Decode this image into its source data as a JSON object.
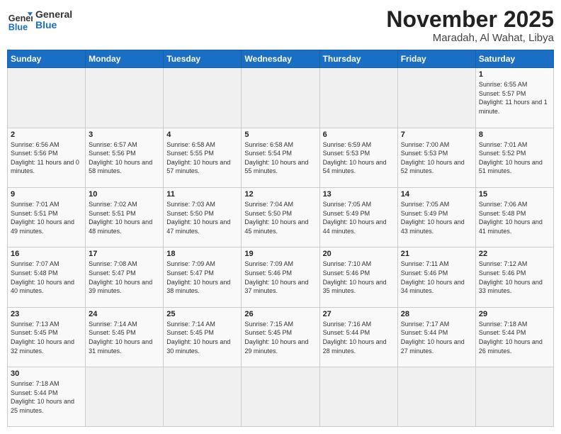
{
  "header": {
    "logo_general": "General",
    "logo_blue": "Blue",
    "month_title": "November 2025",
    "subtitle": "Maradah, Al Wahat, Libya"
  },
  "days_of_week": [
    "Sunday",
    "Monday",
    "Tuesday",
    "Wednesday",
    "Thursday",
    "Friday",
    "Saturday"
  ],
  "weeks": [
    [
      {
        "day": "",
        "sunrise": "",
        "sunset": "",
        "daylight": ""
      },
      {
        "day": "",
        "sunrise": "",
        "sunset": "",
        "daylight": ""
      },
      {
        "day": "",
        "sunrise": "",
        "sunset": "",
        "daylight": ""
      },
      {
        "day": "",
        "sunrise": "",
        "sunset": "",
        "daylight": ""
      },
      {
        "day": "",
        "sunrise": "",
        "sunset": "",
        "daylight": ""
      },
      {
        "day": "",
        "sunrise": "",
        "sunset": "",
        "daylight": ""
      },
      {
        "day": "1",
        "sunrise": "6:55 AM",
        "sunset": "5:57 PM",
        "daylight": "11 hours and 1 minute."
      }
    ],
    [
      {
        "day": "2",
        "sunrise": "6:56 AM",
        "sunset": "5:56 PM",
        "daylight": "11 hours and 0 minutes."
      },
      {
        "day": "3",
        "sunrise": "6:57 AM",
        "sunset": "5:56 PM",
        "daylight": "10 hours and 58 minutes."
      },
      {
        "day": "4",
        "sunrise": "6:58 AM",
        "sunset": "5:55 PM",
        "daylight": "10 hours and 57 minutes."
      },
      {
        "day": "5",
        "sunrise": "6:58 AM",
        "sunset": "5:54 PM",
        "daylight": "10 hours and 55 minutes."
      },
      {
        "day": "6",
        "sunrise": "6:59 AM",
        "sunset": "5:53 PM",
        "daylight": "10 hours and 54 minutes."
      },
      {
        "day": "7",
        "sunrise": "7:00 AM",
        "sunset": "5:53 PM",
        "daylight": "10 hours and 52 minutes."
      },
      {
        "day": "8",
        "sunrise": "7:01 AM",
        "sunset": "5:52 PM",
        "daylight": "10 hours and 51 minutes."
      }
    ],
    [
      {
        "day": "9",
        "sunrise": "7:01 AM",
        "sunset": "5:51 PM",
        "daylight": "10 hours and 49 minutes."
      },
      {
        "day": "10",
        "sunrise": "7:02 AM",
        "sunset": "5:51 PM",
        "daylight": "10 hours and 48 minutes."
      },
      {
        "day": "11",
        "sunrise": "7:03 AM",
        "sunset": "5:50 PM",
        "daylight": "10 hours and 47 minutes."
      },
      {
        "day": "12",
        "sunrise": "7:04 AM",
        "sunset": "5:50 PM",
        "daylight": "10 hours and 45 minutes."
      },
      {
        "day": "13",
        "sunrise": "7:05 AM",
        "sunset": "5:49 PM",
        "daylight": "10 hours and 44 minutes."
      },
      {
        "day": "14",
        "sunrise": "7:05 AM",
        "sunset": "5:49 PM",
        "daylight": "10 hours and 43 minutes."
      },
      {
        "day": "15",
        "sunrise": "7:06 AM",
        "sunset": "5:48 PM",
        "daylight": "10 hours and 41 minutes."
      }
    ],
    [
      {
        "day": "16",
        "sunrise": "7:07 AM",
        "sunset": "5:48 PM",
        "daylight": "10 hours and 40 minutes."
      },
      {
        "day": "17",
        "sunrise": "7:08 AM",
        "sunset": "5:47 PM",
        "daylight": "10 hours and 39 minutes."
      },
      {
        "day": "18",
        "sunrise": "7:09 AM",
        "sunset": "5:47 PM",
        "daylight": "10 hours and 38 minutes."
      },
      {
        "day": "19",
        "sunrise": "7:09 AM",
        "sunset": "5:46 PM",
        "daylight": "10 hours and 37 minutes."
      },
      {
        "day": "20",
        "sunrise": "7:10 AM",
        "sunset": "5:46 PM",
        "daylight": "10 hours and 35 minutes."
      },
      {
        "day": "21",
        "sunrise": "7:11 AM",
        "sunset": "5:46 PM",
        "daylight": "10 hours and 34 minutes."
      },
      {
        "day": "22",
        "sunrise": "7:12 AM",
        "sunset": "5:46 PM",
        "daylight": "10 hours and 33 minutes."
      }
    ],
    [
      {
        "day": "23",
        "sunrise": "7:13 AM",
        "sunset": "5:45 PM",
        "daylight": "10 hours and 32 minutes."
      },
      {
        "day": "24",
        "sunrise": "7:14 AM",
        "sunset": "5:45 PM",
        "daylight": "10 hours and 31 minutes."
      },
      {
        "day": "25",
        "sunrise": "7:14 AM",
        "sunset": "5:45 PM",
        "daylight": "10 hours and 30 minutes."
      },
      {
        "day": "26",
        "sunrise": "7:15 AM",
        "sunset": "5:45 PM",
        "daylight": "10 hours and 29 minutes."
      },
      {
        "day": "27",
        "sunrise": "7:16 AM",
        "sunset": "5:44 PM",
        "daylight": "10 hours and 28 minutes."
      },
      {
        "day": "28",
        "sunrise": "7:17 AM",
        "sunset": "5:44 PM",
        "daylight": "10 hours and 27 minutes."
      },
      {
        "day": "29",
        "sunrise": "7:18 AM",
        "sunset": "5:44 PM",
        "daylight": "10 hours and 26 minutes."
      }
    ],
    [
      {
        "day": "30",
        "sunrise": "7:18 AM",
        "sunset": "5:44 PM",
        "daylight": "10 hours and 25 minutes."
      },
      {
        "day": "",
        "sunrise": "",
        "sunset": "",
        "daylight": ""
      },
      {
        "day": "",
        "sunrise": "",
        "sunset": "",
        "daylight": ""
      },
      {
        "day": "",
        "sunrise": "",
        "sunset": "",
        "daylight": ""
      },
      {
        "day": "",
        "sunrise": "",
        "sunset": "",
        "daylight": ""
      },
      {
        "day": "",
        "sunrise": "",
        "sunset": "",
        "daylight": ""
      },
      {
        "day": "",
        "sunrise": "",
        "sunset": "",
        "daylight": ""
      }
    ]
  ],
  "labels": {
    "sunrise": "Sunrise:",
    "sunset": "Sunset:",
    "daylight": "Daylight:"
  }
}
